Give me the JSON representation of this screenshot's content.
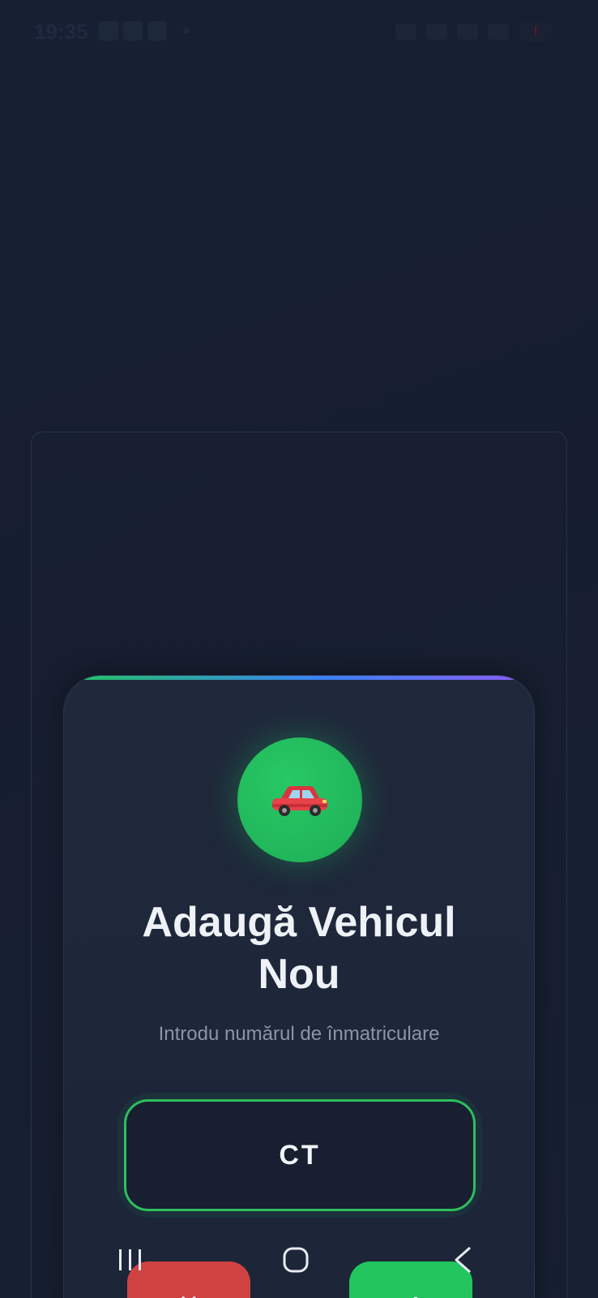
{
  "status_bar": {
    "time": "19:35",
    "battery_text": "!"
  },
  "modal": {
    "title": "Adaugă Vehicul Nou",
    "subtitle": "Introdu numărul de înmatriculare",
    "plate_input_value": "CT",
    "car_emoji": "🚗",
    "cancel_label": "✕",
    "confirm_label": "✓",
    "accent_colors": [
      "#22c55e",
      "#3b82f6",
      "#8b5cf6"
    ]
  },
  "nav_bar": {
    "recents": "recents-icon",
    "home": "home-icon",
    "back": "back-icon"
  }
}
